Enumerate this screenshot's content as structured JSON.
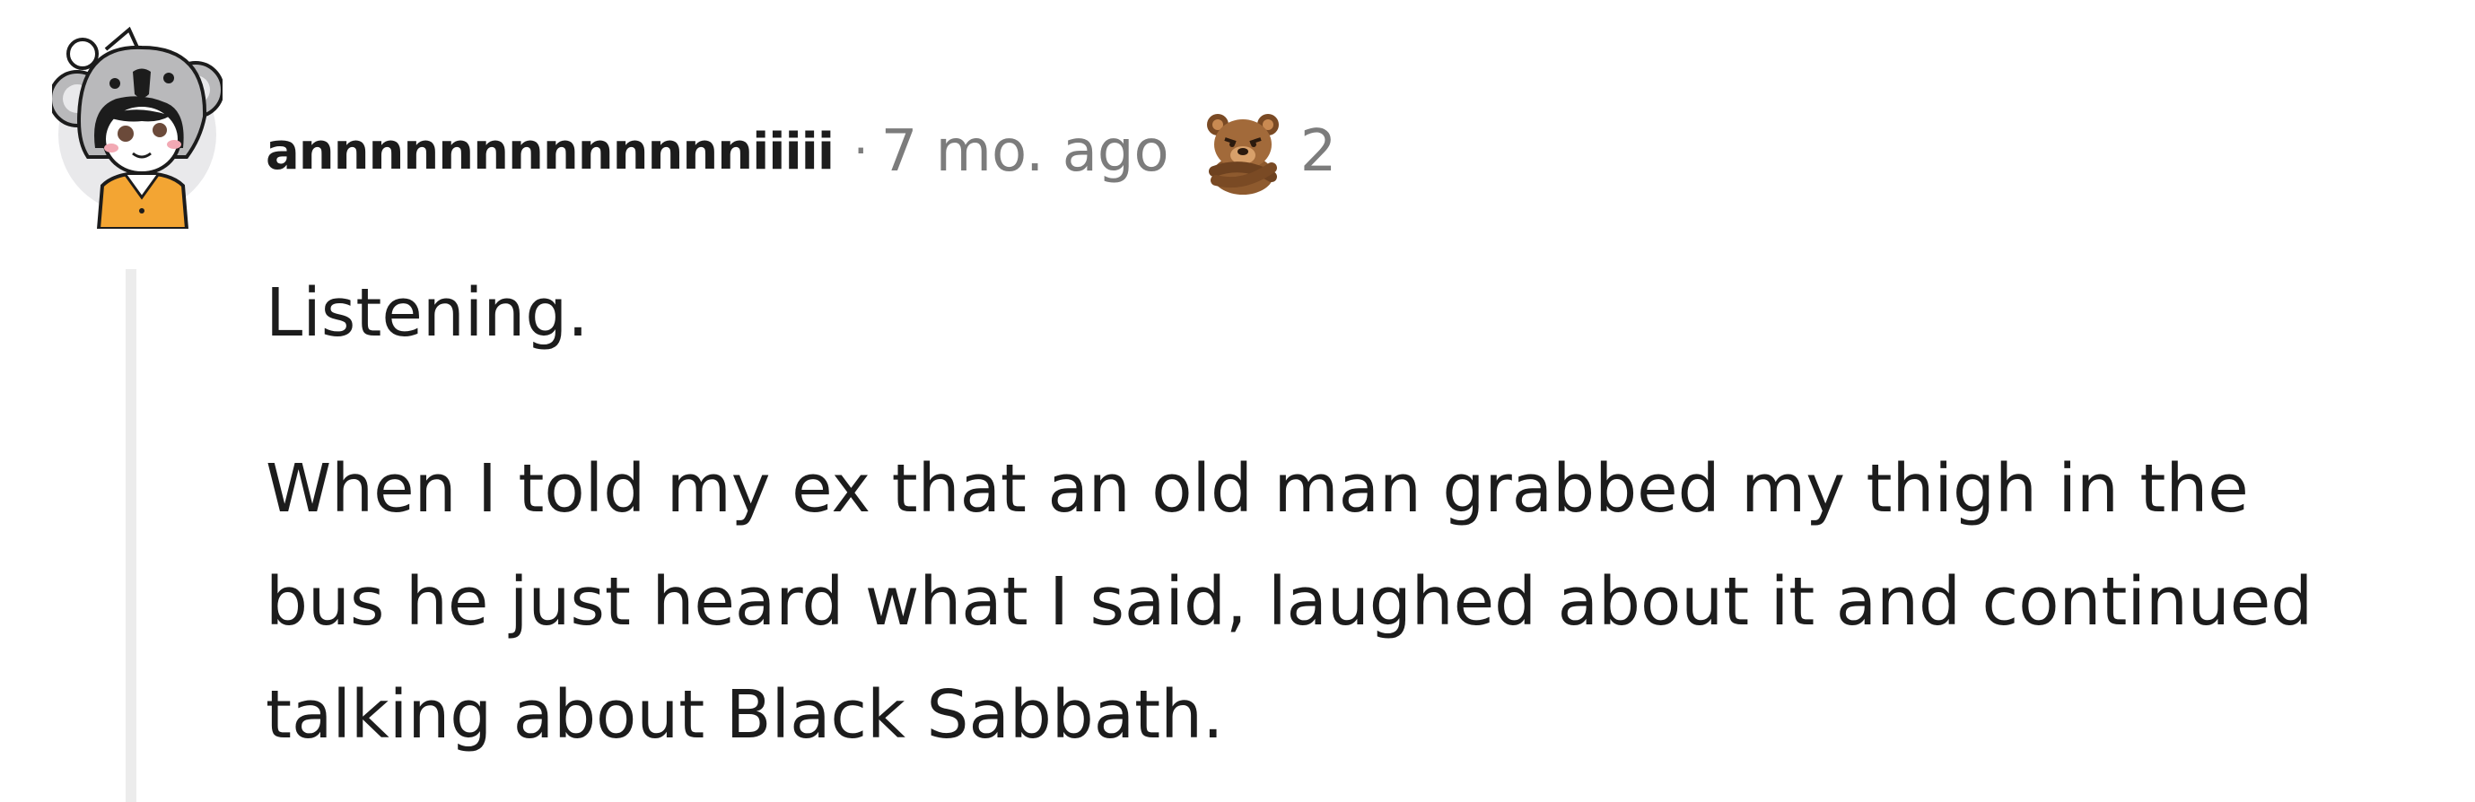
{
  "comment": {
    "username": "annnnnnnnnnnnniiiii",
    "separator": "·",
    "timestamp": "7 mo. ago",
    "award": {
      "icon": "bear-award-icon",
      "count": "2"
    },
    "paragraphs": [
      "Listening.",
      "When I told my ex that an old man grabbed my thigh in the bus he just heard what I said, laughed about it and continued talking about Black Sabbath."
    ]
  },
  "colors": {
    "text": "#1c1c1c",
    "meta": "#7c7c7c",
    "thread_line": "#ececec",
    "avatar_bg": "#e9e9eb",
    "avatar_shirt": "#f3a533",
    "award_brown": "#a26a3a"
  }
}
